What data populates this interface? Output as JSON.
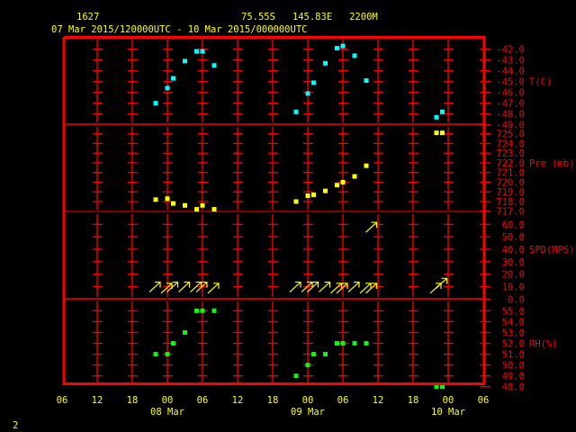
{
  "header": {
    "station_id": "1627",
    "location": "75.55S   145.83E   2200M",
    "period": "07 Mar 2015/120000UTC - 10 Mar 2015/000000UTC"
  },
  "footer": {
    "page_number": "2"
  },
  "colors": {
    "frame": "#ff0000",
    "text": "#ffff00",
    "temperature": "#00ffff",
    "pressure": "#ffff00",
    "wind": "#ffff00",
    "rh": "#00ff00"
  },
  "x_axis": {
    "unit": "hours since 07 Mar 06UTC",
    "range": [
      0,
      72
    ],
    "tick_hours": [
      0,
      6,
      12,
      18,
      24,
      30,
      36,
      42,
      48,
      54,
      60,
      66,
      72
    ],
    "tick_labels": [
      "06",
      "12",
      "18",
      "00",
      "06",
      "12",
      "18",
      "00",
      "06",
      "12",
      "18",
      "00",
      "06"
    ],
    "date_labels": [
      {
        "hour": 18,
        "label": "08 Mar"
      },
      {
        "hour": 42,
        "label": "09 Mar"
      },
      {
        "hour": 66,
        "label": "10 Mar"
      }
    ]
  },
  "chart_data": [
    {
      "type": "scatter",
      "name": "temperature",
      "ylabel": "T(C)",
      "ylim": [
        -49,
        -42
      ],
      "yticks": [
        "-42.0",
        "-43.0",
        "-44.0",
        "-45.0",
        "-46.0",
        "-47.0",
        "-48.0",
        "-49.0"
      ],
      "ytick_values": [
        -42,
        -43,
        -44,
        -45,
        -46,
        -47,
        -48,
        -49
      ],
      "label_at": -45,
      "x": [
        16,
        18,
        19,
        21,
        23,
        24,
        26,
        40,
        42,
        43,
        45,
        47,
        48,
        50,
        52,
        64,
        65
      ],
      "y": [
        -47.0,
        -45.6,
        -44.7,
        -43.1,
        -42.2,
        -42.2,
        -43.5,
        -47.8,
        -46.1,
        -45.1,
        -43.3,
        -41.9,
        -41.7,
        -42.6,
        -44.9,
        -48.3,
        -47.8
      ]
    },
    {
      "type": "scatter",
      "name": "pressure",
      "ylabel": "Pre (mb)",
      "ylim": [
        717,
        725
      ],
      "yticks": [
        "725.0",
        "724.0",
        "723.0",
        "722.0",
        "721.0",
        "720.0",
        "719.0",
        "718.0",
        "717.0"
      ],
      "ytick_values": [
        725,
        724,
        723,
        722,
        721,
        720,
        719,
        718,
        717
      ],
      "label_at": 722,
      "x": [
        16,
        18,
        19,
        21,
        23,
        24,
        26,
        40,
        42,
        43,
        45,
        47,
        48,
        50,
        52,
        64,
        65
      ],
      "y": [
        718.2,
        718.3,
        717.8,
        717.6,
        717.2,
        717.6,
        717.2,
        718.0,
        718.6,
        718.7,
        719.1,
        719.7,
        720.0,
        720.6,
        721.7,
        725.1,
        725.1
      ]
    },
    {
      "type": "scatter",
      "name": "wind",
      "ylabel": "SPD(MPS)",
      "ylim": [
        0,
        60
      ],
      "yticks": [
        "60.0",
        "50.0",
        "40.0",
        "30.0",
        "20.0",
        "10.0",
        "0.0"
      ],
      "ytick_values": [
        60,
        50,
        40,
        30,
        20,
        10,
        0
      ],
      "label_at": 40,
      "x": [
        16,
        18,
        19,
        21,
        23,
        24,
        26,
        40,
        42,
        43,
        45,
        47,
        48,
        50,
        52,
        53,
        53,
        64,
        65
      ],
      "y": [
        10,
        9,
        10,
        10,
        10,
        10,
        9,
        10,
        10,
        10,
        10,
        9,
        9,
        10,
        9,
        9,
        58,
        9,
        13
      ],
      "direction_deg": 225
    },
    {
      "type": "scatter",
      "name": "relative-humidity",
      "ylabel": "RH(%)",
      "ylim": [
        48,
        55
      ],
      "yticks": [
        "55.0",
        "54.0",
        "53.0",
        "52.0",
        "51.0",
        "50.0",
        "49.0",
        "48.0"
      ],
      "ytick_values": [
        55,
        54,
        53,
        52,
        51,
        50,
        49,
        48
      ],
      "label_at": 52,
      "x": [
        16,
        18,
        19,
        21,
        23,
        24,
        26,
        40,
        42,
        43,
        45,
        47,
        48,
        50,
        52,
        64,
        65
      ],
      "y": [
        51,
        51,
        52,
        53,
        55,
        55,
        55,
        49,
        50,
        51,
        51,
        52,
        52,
        52,
        52,
        48,
        48
      ]
    }
  ]
}
